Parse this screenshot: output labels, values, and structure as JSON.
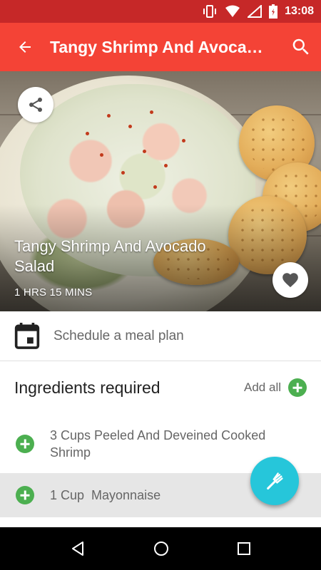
{
  "status_bar": {
    "time": "13:08",
    "icons": [
      "vibrate-icon",
      "wifi-icon",
      "signal-icon",
      "battery-icon"
    ]
  },
  "app_bar": {
    "title": "Tangy Shrimp And Avocado Salad",
    "back_icon": "arrow-back-icon",
    "search_icon": "search-icon"
  },
  "recipe": {
    "title": "Tangy Shrimp And Avocado Salad",
    "time": "1 HRS 15 MINS",
    "share_icon": "share-icon",
    "favorite_icon": "heart-icon"
  },
  "schedule": {
    "label": "Schedule a meal plan",
    "icon": "calendar-icon"
  },
  "ingredients": {
    "header": "Ingredients required",
    "add_all": "Add all",
    "items": [
      {
        "text": "3 Cups Peeled And Deveined Cooked Shrimp"
      },
      {
        "text": "1 Cup  Mayonnaise"
      }
    ]
  },
  "fab_icon": "fork-icon",
  "nav_bar": {
    "icons": [
      "back-triangle-icon",
      "home-circle-icon",
      "recents-square-icon"
    ]
  },
  "colors": {
    "app_bar": "#F44336",
    "status_bar": "#C62828",
    "accent_plus": "#4CAF50",
    "fab": "#26C6DA"
  }
}
